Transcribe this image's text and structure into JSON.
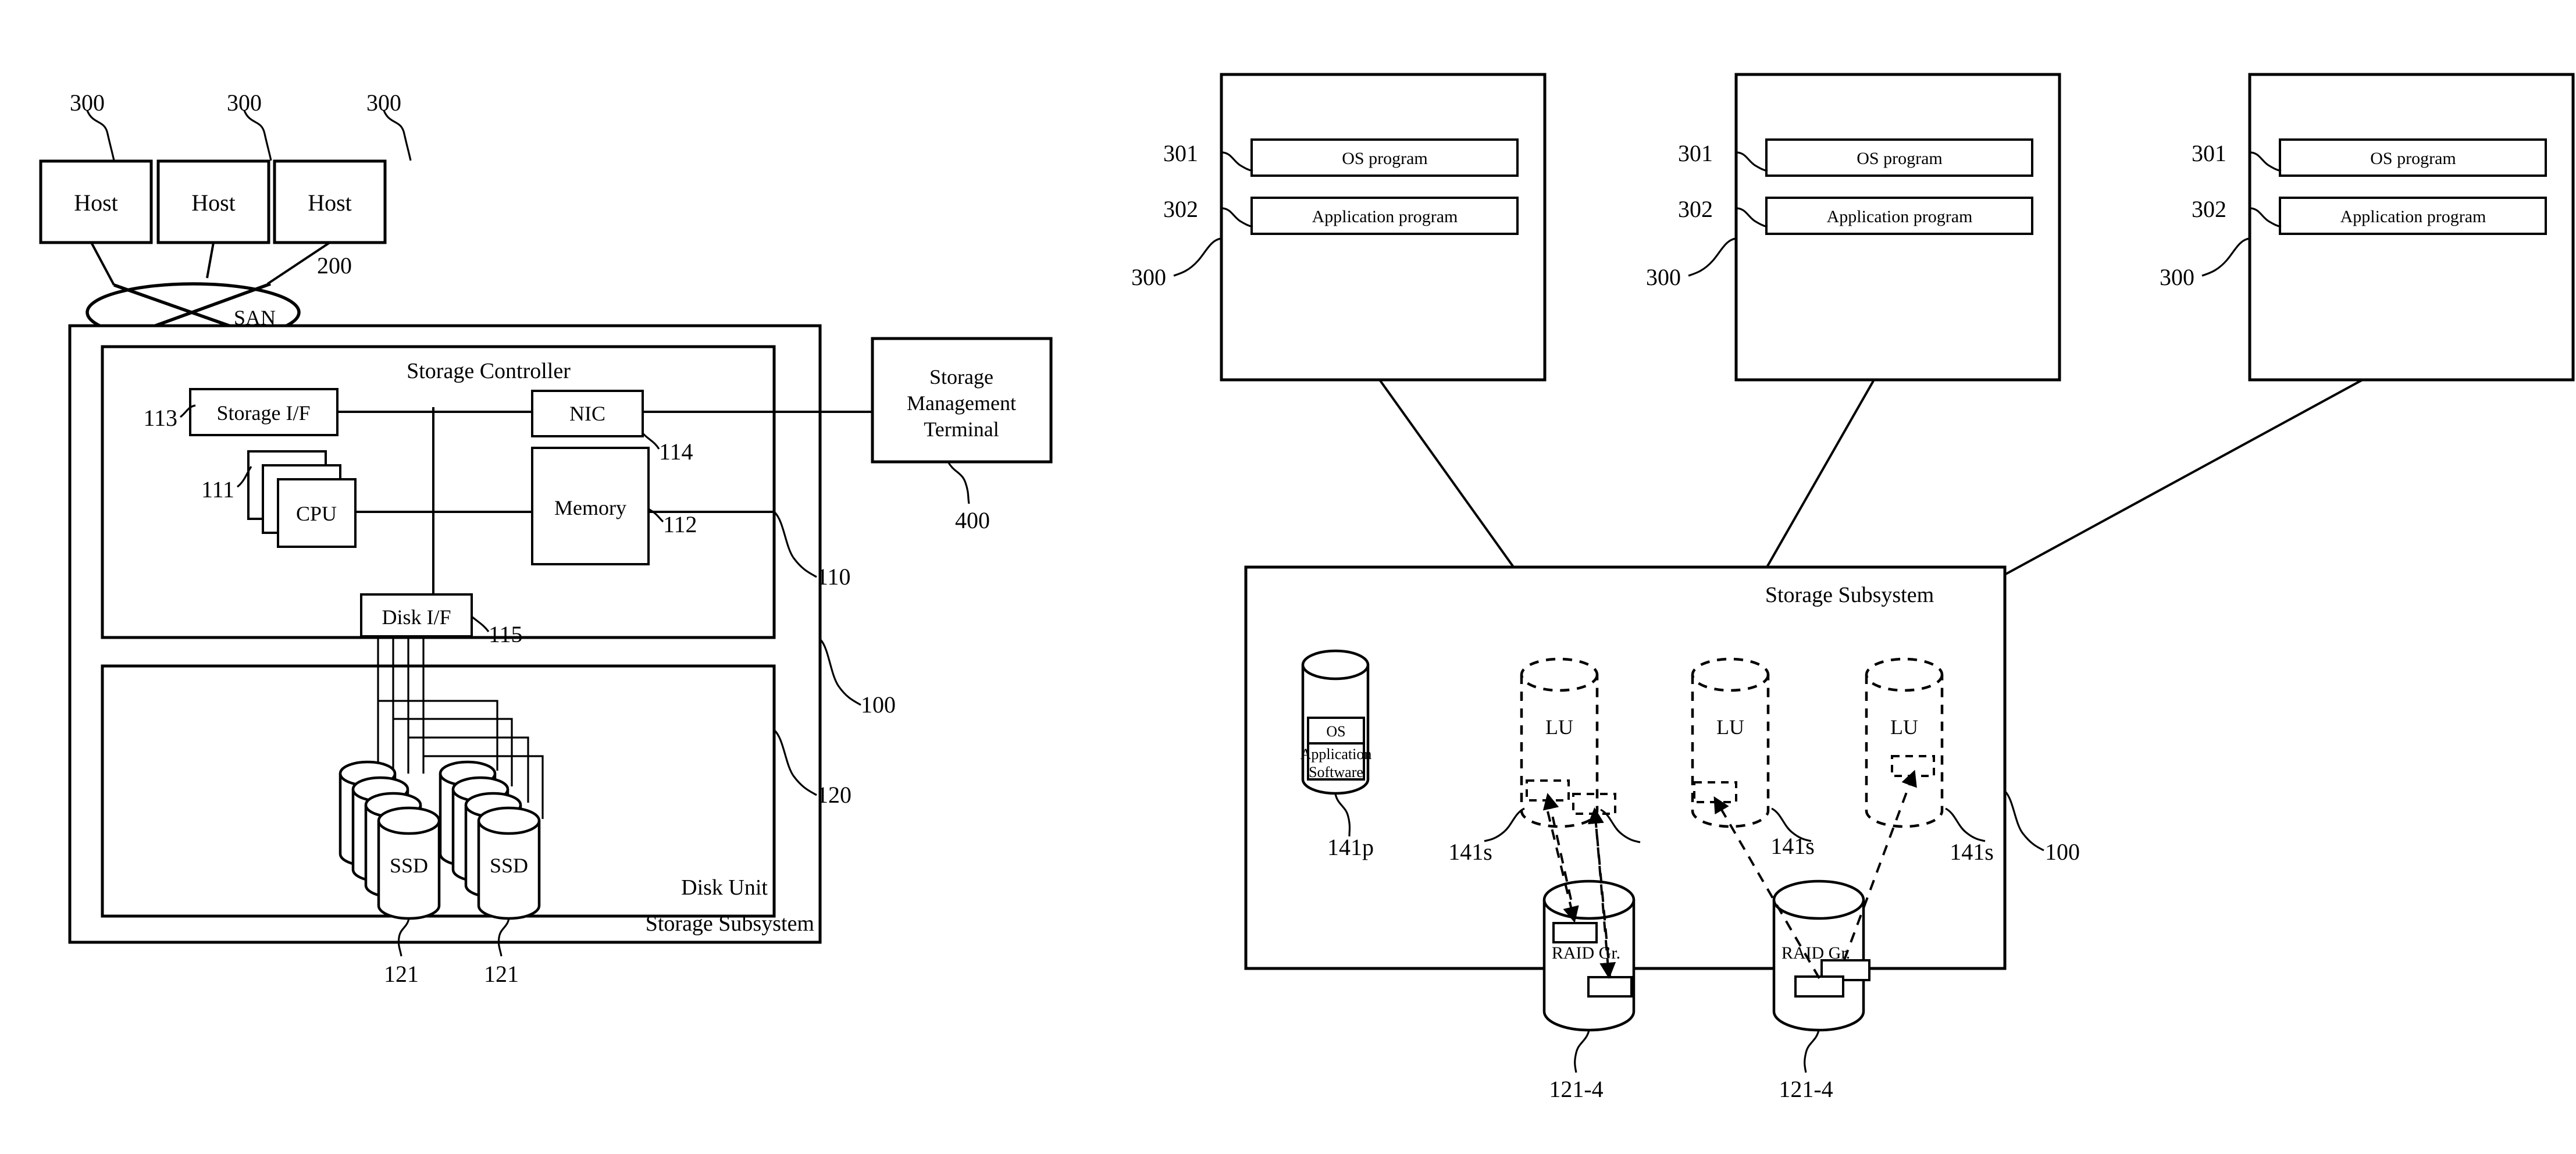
{
  "figure_left": {
    "hosts": [
      {
        "label": "Host",
        "ref": "300"
      },
      {
        "label": "Host",
        "ref": "300"
      },
      {
        "label": "Host",
        "ref": "300"
      }
    ],
    "network": {
      "label": "SAN",
      "ref": "200"
    },
    "subsystem_label": "Storage Subsystem",
    "subsystem_ref": "100",
    "controller": {
      "label": "Storage Controller",
      "ref": "110",
      "blocks": [
        {
          "label": "Storage I/F",
          "ref": "113"
        },
        {
          "label": "NIC",
          "ref": "114"
        },
        {
          "label": "CPU",
          "ref": "111"
        },
        {
          "label": "Memory",
          "ref": "112"
        },
        {
          "label": "Disk I/F",
          "ref": "115"
        }
      ]
    },
    "disk_unit": {
      "label": "Disk Unit",
      "ref": "120",
      "drives": [
        {
          "label": "SSD",
          "ref": "121"
        },
        {
          "label": "SSD",
          "ref": "121"
        }
      ]
    },
    "management_terminal": {
      "line1": "Storage",
      "line2": "Management",
      "line3": "Terminal",
      "ref": "400"
    }
  },
  "figure_right": {
    "hosts": [
      {
        "ref": "300",
        "programs": [
          {
            "label": "OS program",
            "ref": "301"
          },
          {
            "label": "Application program",
            "ref": "302"
          }
        ]
      },
      {
        "ref": "300",
        "programs": [
          {
            "label": "OS program",
            "ref": "301"
          },
          {
            "label": "Application program",
            "ref": "302"
          }
        ]
      },
      {
        "ref": "300",
        "programs": [
          {
            "label": "OS program",
            "ref": "301"
          },
          {
            "label": "Application program",
            "ref": "302"
          }
        ]
      }
    ],
    "subsystem": {
      "label": "Storage Subsystem",
      "ref": "100",
      "boot_volume": {
        "os_label": "OS",
        "app_line1": "Application",
        "app_line2": "Software",
        "ref": "141p"
      },
      "logical_units": [
        {
          "label": "LU",
          "ref": "141s"
        },
        {
          "label": "LU",
          "ref": "141s"
        },
        {
          "label": "LU",
          "ref": "141s"
        }
      ],
      "raid_groups": [
        {
          "label": "RAID Gr.",
          "ref": "121-4"
        },
        {
          "label": "RAID Gr.",
          "ref": "121-4"
        }
      ]
    }
  }
}
